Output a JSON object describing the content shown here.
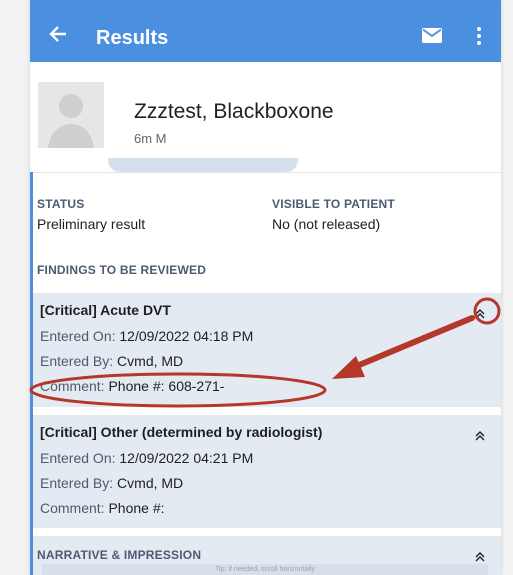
{
  "app_bar": {
    "title": "Results",
    "back_icon": "arrow-back-icon",
    "mail_icon": "mail-icon",
    "more_icon": "more-vert-icon",
    "color": "#4a8fe0"
  },
  "patient": {
    "name": "Zzztest, Blackboxone",
    "age_sex": "6m M"
  },
  "status": {
    "label": "STATUS",
    "value": "Preliminary result"
  },
  "visible_to_patient": {
    "label": "VISIBLE TO PATIENT",
    "value": "No (not released)"
  },
  "findings": {
    "header": "FINDINGS TO BE REVIEWED",
    "items": [
      {
        "title": "[Critical] Acute DVT",
        "entered_on_label": "Entered On:",
        "entered_on": "12/09/2022 04:18 PM",
        "entered_by_label": "Entered By:",
        "entered_by": "Cvmd, MD",
        "comment_label": "Comment:",
        "comment": "Phone #: 608-271-"
      },
      {
        "title": "[Critical] Other (determined by radiologist)",
        "entered_on_label": "Entered On:",
        "entered_on": "12/09/2022 04:21 PM",
        "entered_by_label": "Entered By:",
        "entered_by": "Cvmd, MD",
        "comment_label": "Comment:",
        "comment": "Phone #:"
      }
    ]
  },
  "narrative": {
    "header": "NARRATIVE & IMPRESSION",
    "tip": "Tip: if needed, scroll horizontally"
  },
  "annotation_color": "#b5372a"
}
